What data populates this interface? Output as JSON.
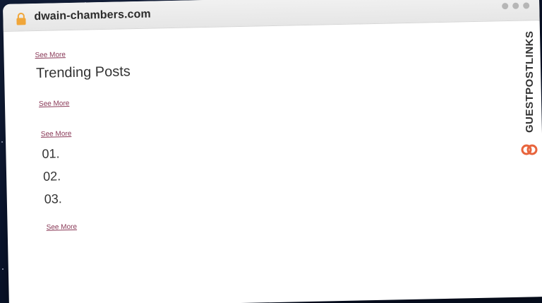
{
  "browser": {
    "url": "dwain-chambers.com"
  },
  "page": {
    "see_more_1": "See More",
    "heading": "Trending Posts",
    "see_more_2": "See More",
    "see_more_3": "See More",
    "numbers": [
      "01.",
      "02.",
      "03."
    ],
    "see_more_4": "See More"
  },
  "brand": {
    "text": "GUESTPOSTLINKS",
    "color": "#e8643c"
  },
  "colors": {
    "link": "#8a3a58",
    "lock": "#f0a63a"
  }
}
